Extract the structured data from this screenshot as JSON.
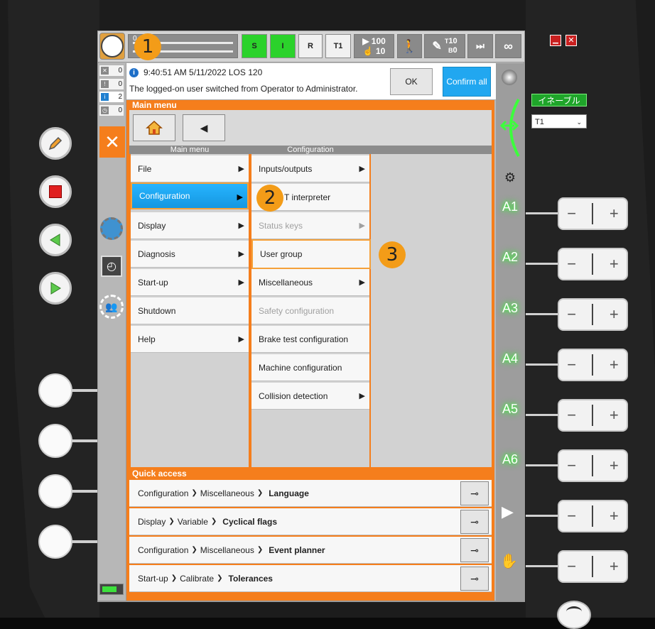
{
  "topbar": {
    "indicators": [
      "S",
      "I",
      "R",
      "T1"
    ],
    "override_prog": "100",
    "override_jog": "10",
    "tool_num": "10",
    "base_num": "0",
    "tool_prefix": "T",
    "base_prefix": "B",
    "infinity": "∞",
    "slider_digit": "0"
  },
  "counters": [
    "0",
    "0",
    "2",
    "0"
  ],
  "message": {
    "time_line": "9:40:51 AM 5/11/2022 LOS 120",
    "text": "The logged-on user switched from Operator to Administrator.",
    "ok_label": "OK",
    "confirm_label": "Confirm all"
  },
  "main_menu": {
    "title": "Main menu",
    "col1_header": "Main menu",
    "col2_header": "Configuration",
    "col1_items": [
      {
        "label": "File",
        "arrow": "▶"
      },
      {
        "label": "Configuration",
        "arrow": "▶"
      },
      {
        "label": "Display",
        "arrow": "▶"
      },
      {
        "label": "Diagnosis",
        "arrow": "▶"
      },
      {
        "label": "Start-up",
        "arrow": "▶"
      },
      {
        "label": "Shutdown",
        "arrow": ""
      },
      {
        "label": "Help",
        "arrow": "▶"
      }
    ],
    "col2_items": [
      {
        "label": "Inputs/outputs",
        "arrow": "▶"
      },
      {
        "label": "T interpreter",
        "arrow": ""
      },
      {
        "label": "Status keys",
        "arrow": "▶"
      },
      {
        "label": "User group",
        "arrow": ""
      },
      {
        "label": "Miscellaneous",
        "arrow": "▶"
      },
      {
        "label": "Safety configuration",
        "arrow": ""
      },
      {
        "label": "Brake test configuration",
        "arrow": ""
      },
      {
        "label": "Machine configuration",
        "arrow": ""
      },
      {
        "label": "Collision detection",
        "arrow": "▶"
      }
    ]
  },
  "quick_access": {
    "title": "Quick access",
    "rows": [
      {
        "p1": "Configuration",
        "p2": "Miscellaneous",
        "last": "Language"
      },
      {
        "p1": "Display",
        "p2": "Variable",
        "last": "Cyclical flags"
      },
      {
        "p1": "Configuration",
        "p2": "Miscellaneous",
        "last": "Event planner"
      },
      {
        "p1": "Start-up",
        "p2": "Calibrate",
        "last": "Tolerances"
      }
    ]
  },
  "right_panel": {
    "enable_label": "イネーブル",
    "mode_select": "T1",
    "axes": [
      "A1",
      "A2",
      "A3",
      "A4",
      "A5",
      "A6"
    ]
  },
  "badges": [
    "1",
    "2",
    "3"
  ],
  "colors": {
    "accent": "#f57e1c",
    "selected": "#1ea6f0",
    "badge": "#f39c18",
    "green": "#2bd22b"
  }
}
